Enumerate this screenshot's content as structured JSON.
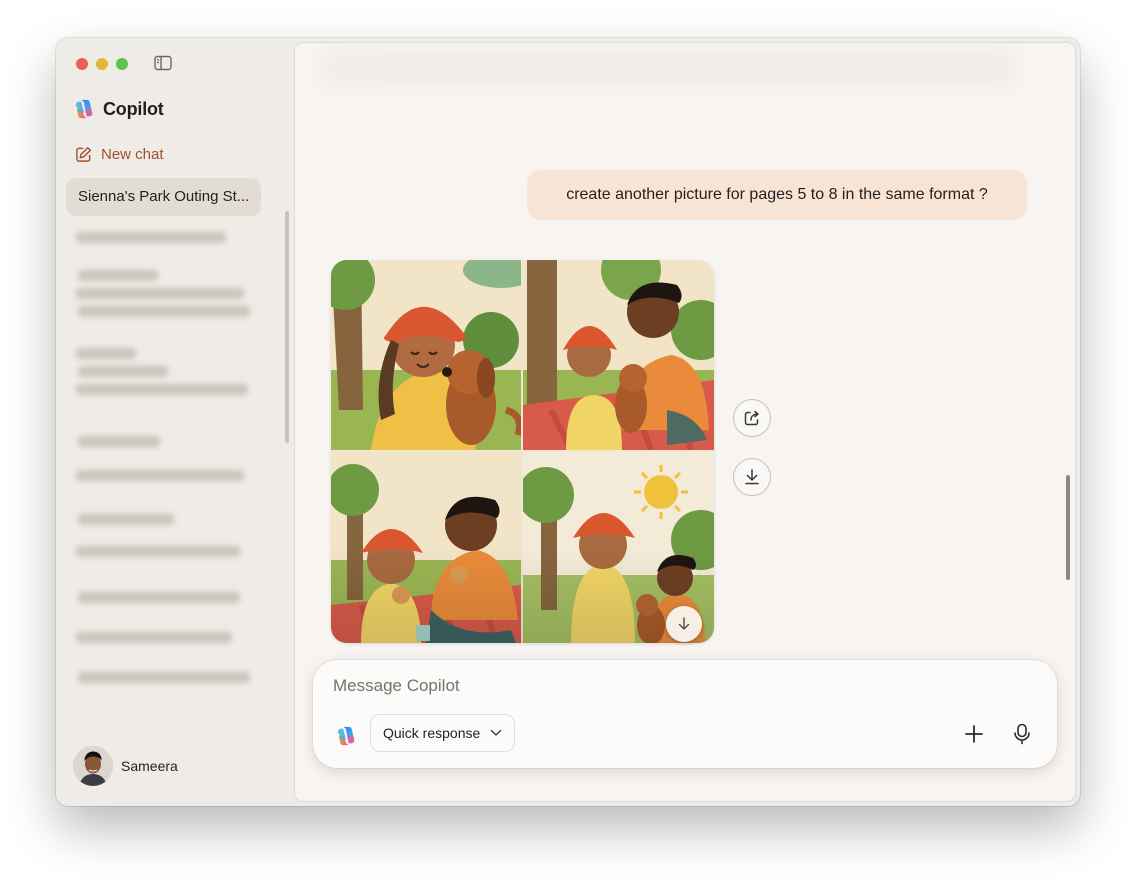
{
  "app": {
    "name": "Copilot",
    "window_controls": [
      "close",
      "minimize",
      "zoom"
    ],
    "sidebar_toggle_icon": "sidebar-toggle-icon"
  },
  "sidebar": {
    "new_chat_label": "New chat",
    "new_chat_icon": "compose-icon",
    "active_conversation": "Sienna's Park Outing St...",
    "history_items_obscured": true
  },
  "user": {
    "name": "Sameera",
    "avatar_icon": "user-avatar"
  },
  "conversation": {
    "user_message": "create another picture for pages 5 to 8 in the same format ?",
    "generated_image": {
      "panels": [
        "girl in orange hat hugging brown puppy in park",
        "girl, puppy and man sitting on red checkered picnic blanket",
        "girl and man eating sandwiches on picnic blanket",
        "girl, man and puppy under the sun in the park"
      ],
      "download_overlay_icon": "arrow-down-icon"
    },
    "image_actions": [
      {
        "name": "share",
        "icon": "share-icon"
      },
      {
        "name": "download",
        "icon": "download-icon"
      }
    ]
  },
  "composer": {
    "placeholder": "Message Copilot",
    "value": "",
    "mode_label": "Quick response",
    "mode_icon": "chevron-down-icon",
    "add_icon": "plus-icon",
    "voice_icon": "microphone-icon"
  },
  "colors": {
    "window_background": "#efebe6",
    "main_background": "#f7f4f1",
    "user_bubble": "#f8e4d4",
    "new_chat_accent": "#a3502b",
    "active_item": "#e2dcd5"
  }
}
